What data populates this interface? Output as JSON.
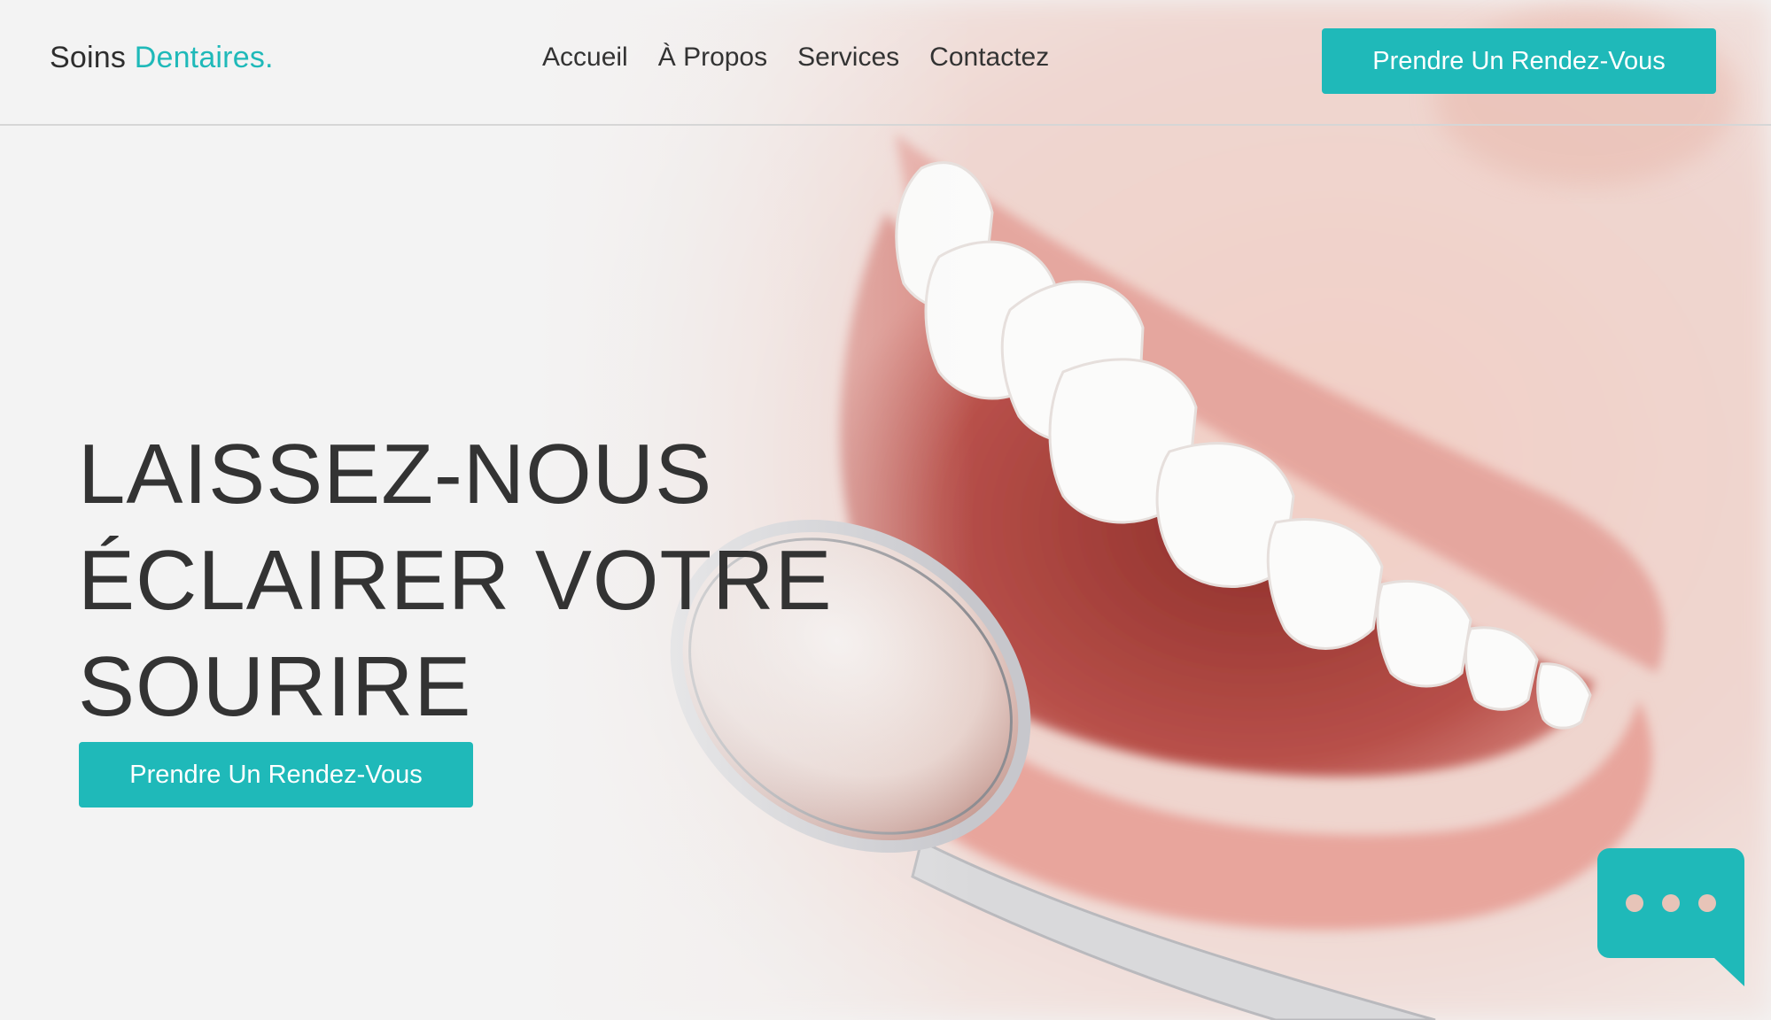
{
  "header": {
    "brand": {
      "name": "Soins ",
      "accent": "Dentaires."
    },
    "nav": [
      {
        "label": "Accueil"
      },
      {
        "label": "À Propos"
      },
      {
        "label": "Services"
      },
      {
        "label": "Contactez"
      }
    ],
    "cta_label": "Prendre Un Rendez-Vous"
  },
  "hero": {
    "headline_lines": [
      "LAISSEZ-NOUS",
      "ÉCLAIRER VOTRE",
      "SOURIRE"
    ],
    "cta_label": "Prendre Un Rendez-Vous",
    "image": "smile-with-dental-mirror-photo"
  },
  "chat_widget": {
    "icon": "chat-bubble-icon"
  },
  "colors": {
    "accent": "#1fb9b9",
    "text": "#333333",
    "background": "#f3f3f3"
  }
}
